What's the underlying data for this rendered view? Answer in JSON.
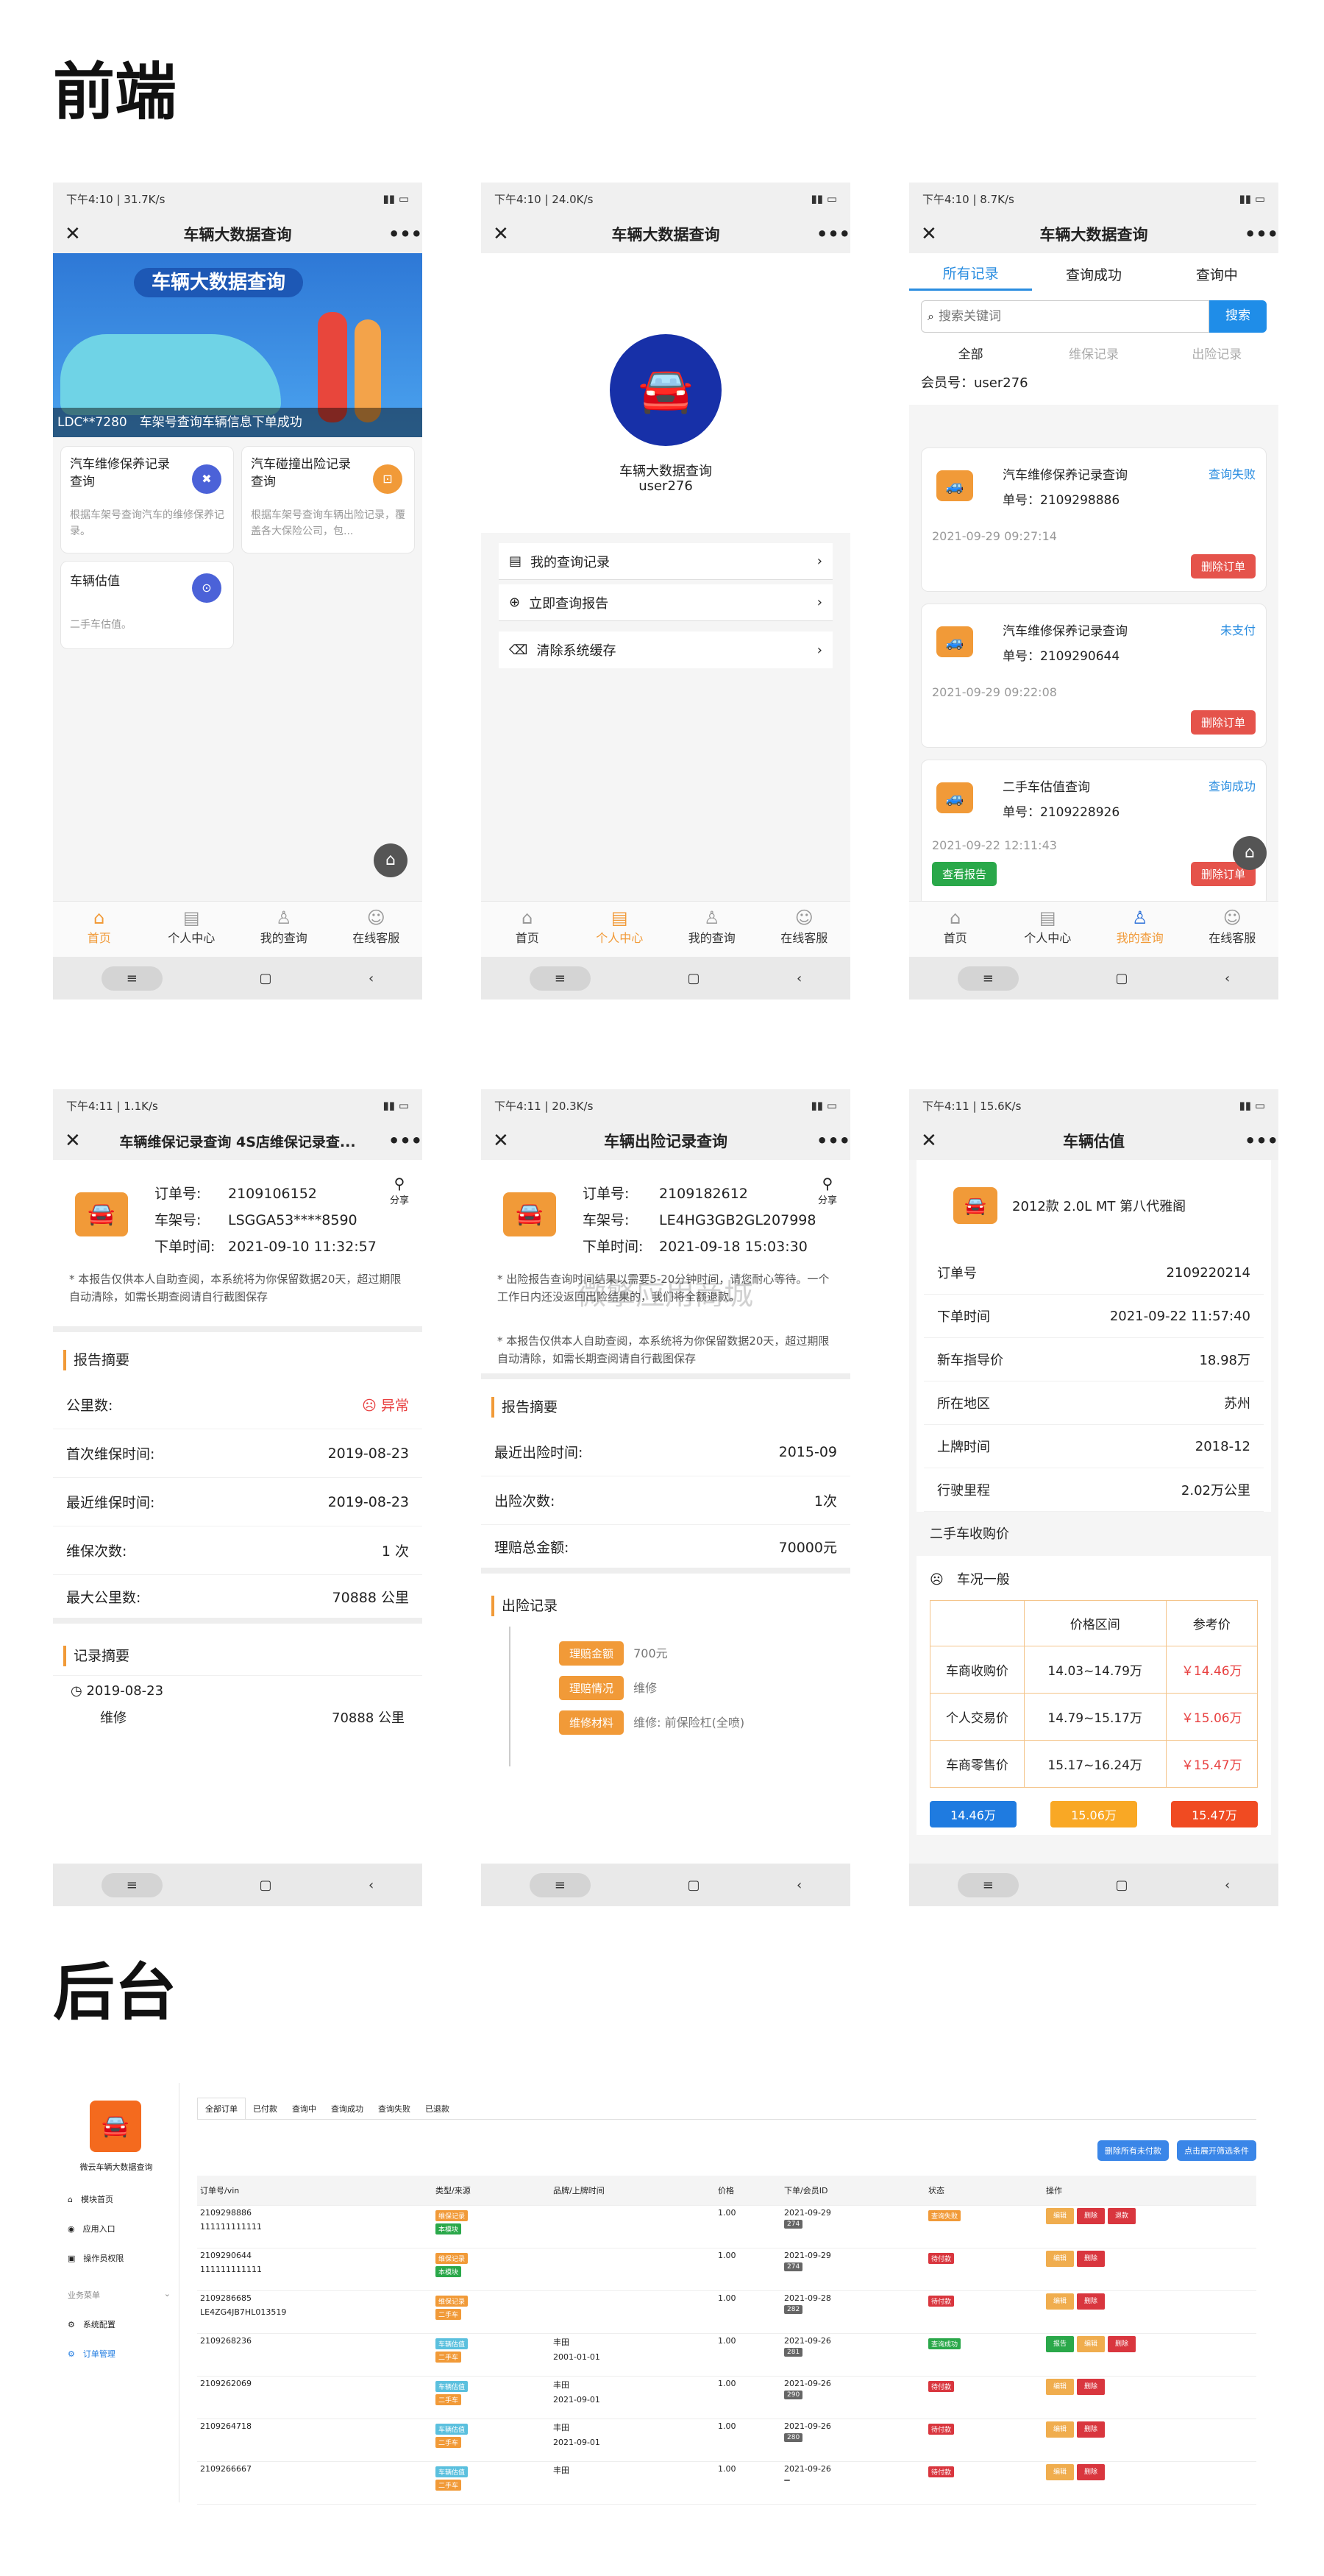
{
  "sections": {
    "front": "前端",
    "back": "后台"
  },
  "watermark": "微擎应用商城",
  "status": {
    "p1": "下午4:10 | 31.7K/s",
    "p2": "下午4:10 | 24.0K/s",
    "p3": "下午4:10 | 8.7K/s",
    "p4": "下午4:11 | 1.1K/s",
    "p5": "下午4:11 | 20.3K/s",
    "p6": "下午4:11 | 15.6K/s"
  },
  "s1": {
    "title": "车辆大数据查询",
    "banner_title": "车辆大数据查询",
    "marquee": "LDC**7280　车架号查询车辆信息下单成功",
    "cards": [
      {
        "title": "汽车维修保养记录查询",
        "desc": "根据车架号查询汽车的维修保养记录。"
      },
      {
        "title": "汽车碰撞出险记录查询",
        "desc": "根据车架号查询车辆出险记录，覆盖各大保险公司，包..."
      },
      {
        "title": "车辆估值",
        "desc": "二手车估值。"
      }
    ]
  },
  "tabs": [
    "首页",
    "个人中心",
    "我的查询",
    "在线客服"
  ],
  "s2": {
    "title": "车辆大数据查询",
    "app_name": "车辆大数据查询",
    "user": "user276",
    "menu": [
      "我的查询记录",
      "立即查询报告",
      "清除系统缓存"
    ]
  },
  "s3": {
    "title": "车辆大数据查询",
    "tabs": [
      "所有记录",
      "查询成功",
      "查询中"
    ],
    "search_placeholder": "搜索关键词",
    "search_btn": "搜索",
    "filters": [
      "全部",
      "维保记录",
      "出险记录"
    ],
    "member": "会员号：user276",
    "orders": [
      {
        "name": "汽车维修保养记录查询",
        "no": "单号：2109298886",
        "status": "查询失败",
        "time": "2021-09-29 09:27:14",
        "del": "删除订单"
      },
      {
        "name": "汽车维修保养记录查询",
        "no": "单号：2109290644",
        "status": "未支付",
        "time": "2021-09-29 09:22:08",
        "del": "删除订单"
      },
      {
        "name": "二手车估值查询",
        "no": "单号：2109228926",
        "status": "查询成功",
        "time": "2021-09-22 12:11:43",
        "view": "查看报告",
        "del": "删除订单"
      }
    ]
  },
  "s4": {
    "title": "车辆维保记录查询 4S店维保记录查...",
    "share": "分享",
    "info": [
      {
        "k": "订单号:",
        "v": "2109106152"
      },
      {
        "k": "车架号:",
        "v": "LSGGA53****8590"
      },
      {
        "k": "下单时间:",
        "v": "2021-09-10 11:32:57"
      }
    ],
    "notice": "* 本报告仅供本人自助查阅，本系统将为你保留数据20天，超过期限自动清除，如需长期查阅请自行截图保存",
    "summary_title": "报告摘要",
    "rows": [
      {
        "k": "公里数:",
        "v": "☹ 异常"
      },
      {
        "k": "首次维保时间:",
        "v": "2019-08-23"
      },
      {
        "k": "最近维保时间:",
        "v": "2019-08-23"
      },
      {
        "k": "维保次数:",
        "v": "1 次"
      },
      {
        "k": "最大公里数:",
        "v": "70888 公里"
      }
    ],
    "rec_title": "记录摘要",
    "rec_date": "2019-08-23",
    "rec_type": "维修",
    "rec_km": "70888 公里"
  },
  "s5": {
    "title": "车辆出险记录查询",
    "share": "分享",
    "info": [
      {
        "k": "订单号:",
        "v": "2109182612"
      },
      {
        "k": "车架号:",
        "v": "LE4HG3GB2GL207998"
      },
      {
        "k": "下单时间:",
        "v": "2021-09-18 15:03:30"
      }
    ],
    "notice1": "* 出险报告查询时间结果以需要5-20分钟时间，请您耐心等待。一个工作日内还没返回出险结果的，我们将全额退款。",
    "notice2": "* 本报告仅供本人自助查阅，本系统将为你保留数据20天，超过期限自动清除，如需长期查阅请自行截图保存",
    "summary_title": "报告摘要",
    "rows": [
      {
        "k": "最近出险时间:",
        "v": "2015-09"
      },
      {
        "k": "出险次数:",
        "v": "1次"
      },
      {
        "k": "理赔总金额:",
        "v": "70000元"
      }
    ],
    "rec_title": "出险记录",
    "claims": [
      {
        "k": "理赔金额",
        "v": "700元"
      },
      {
        "k": "理赔情况",
        "v": "维修"
      },
      {
        "k": "维修材料",
        "v": "维修: 前保险杠(全喷)"
      }
    ]
  },
  "s6": {
    "title": "车辆估值",
    "car": "2012款 2.0L MT 第八代雅阁",
    "rows": [
      {
        "k": "订单号",
        "v": "2109220214"
      },
      {
        "k": "下单时间",
        "v": "2021-09-22 11:57:40"
      },
      {
        "k": "新车指导价",
        "v": "18.98万"
      },
      {
        "k": "所在地区",
        "v": "苏州"
      },
      {
        "k": "上牌时间",
        "v": "2018-12"
      },
      {
        "k": "行驶里程",
        "v": "2.02万公里"
      }
    ],
    "buy_title": "二手车收购价",
    "cond": "车况一般",
    "table_head": [
      "",
      "价格区间",
      "参考价"
    ],
    "table": [
      {
        "k": "车商收购价",
        "r": "14.03~14.79万",
        "p": "￥14.46万"
      },
      {
        "k": "个人交易价",
        "r": "14.79~15.17万",
        "p": "￥15.06万"
      },
      {
        "k": "车商零售价",
        "r": "15.17~16.24万",
        "p": "￥15.47万"
      }
    ],
    "pills": [
      "14.46万",
      "15.06万",
      "15.47万"
    ]
  },
  "admin": {
    "app": "微云车辆大数据查询",
    "menu": [
      "模块首页",
      "应用入口",
      "操作员权限"
    ],
    "group": "业务菜单",
    "menu2": [
      "系统配置",
      "订单管理"
    ],
    "tabs": [
      "全部订单",
      "已付款",
      "查询中",
      "查询成功",
      "查询失败",
      "已退款"
    ],
    "btn1": "删除所有未付款",
    "btn2": "点击展开筛选条件",
    "head": [
      "订单号/vin",
      "类型/来源",
      "品牌/上牌时间",
      "价格",
      "下单/会员ID",
      "状态",
      "操作"
    ],
    "rows": [
      {
        "no": "2109298886",
        "vin": "111111111111",
        "type": "维保记录",
        "src": "本模块",
        "brand": "",
        "date2": "",
        "price": "1.00",
        "date": "2021-09-29",
        "uid": "274",
        "st": "查询失败",
        "stc": "#f19a38",
        "ops": [
          "编辑",
          "删除",
          "退款"
        ]
      },
      {
        "no": "2109290644",
        "vin": "111111111111",
        "type": "维保记录",
        "src": "本模块",
        "brand": "",
        "date2": "",
        "price": "1.00",
        "date": "2021-09-29",
        "uid": "274",
        "st": "待付款",
        "stc": "#d9363e",
        "ops": [
          "编辑",
          "删除"
        ]
      },
      {
        "no": "2109286685",
        "vin": "LE4ZG4JB7HL013519",
        "type": "维保记录",
        "src": "二手车",
        "brand": "",
        "date2": "",
        "price": "1.00",
        "date": "2021-09-28",
        "uid": "282",
        "st": "待付款",
        "stc": "#d9363e",
        "ops": [
          "编辑",
          "删除"
        ]
      },
      {
        "no": "2109268236",
        "vin": "",
        "type": "车辆估值",
        "src": "二手车",
        "brand": "丰田",
        "date2": "2001-01-01",
        "price": "1.00",
        "date": "2021-09-26",
        "uid": "281",
        "st": "查询成功",
        "stc": "#2aa84a",
        "ops": [
          "报告",
          "编辑",
          "删除"
        ]
      },
      {
        "no": "2109262069",
        "vin": "",
        "type": "车辆估值",
        "src": "二手车",
        "brand": "丰田",
        "date2": "2021-09-01",
        "price": "1.00",
        "date": "2021-09-26",
        "uid": "290",
        "st": "待付款",
        "stc": "#d9363e",
        "ops": [
          "编辑",
          "删除"
        ]
      },
      {
        "no": "2109264718",
        "vin": "",
        "type": "车辆估值",
        "src": "二手车",
        "brand": "丰田",
        "date2": "2021-09-01",
        "price": "1.00",
        "date": "2021-09-26",
        "uid": "280",
        "st": "待付款",
        "stc": "#d9363e",
        "ops": [
          "编辑",
          "删除"
        ]
      },
      {
        "no": "2109266667",
        "vin": "",
        "type": "车辆估值",
        "src": "二手车",
        "brand": "丰田",
        "date2": "",
        "price": "1.00",
        "date": "2021-09-26",
        "uid": "",
        "st": "待付款",
        "stc": "#d9363e",
        "ops": [
          "编辑",
          "删除"
        ]
      }
    ]
  }
}
